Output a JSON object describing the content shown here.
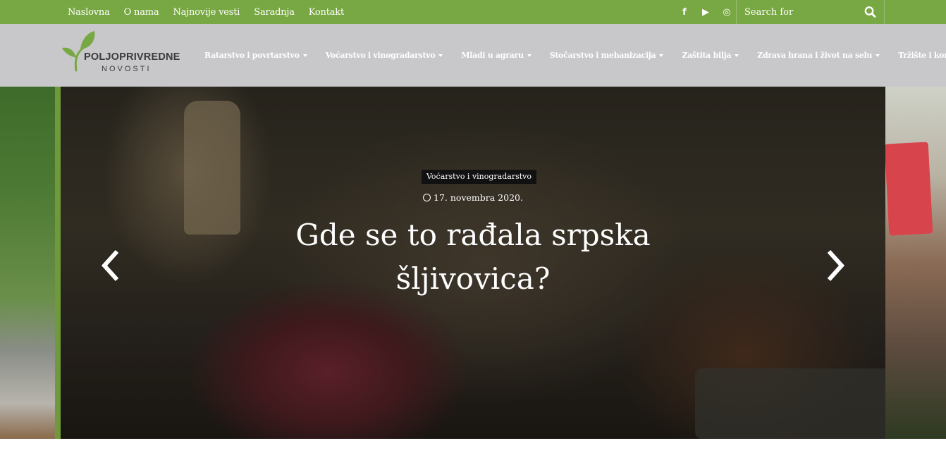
{
  "topbar": {
    "links": [
      "Naslovna",
      "O nama",
      "Najnovije vesti",
      "Saradnja",
      "Kontakt"
    ],
    "social": [
      "f",
      "▶",
      "◎"
    ],
    "social_icons": [
      "facebook-icon",
      "youtube-icon",
      "instagram-icon"
    ],
    "search_placeholder": "Search for",
    "bg_color": "#78a843"
  },
  "header": {
    "logo": {
      "line1": "POLJOPRIVREDNE",
      "line2": "NOVOSTI"
    },
    "nav": [
      "Ratarstvo i povrtarstvo",
      "Voćarstvo i vinogradarstvo",
      "Mladi u agraru",
      "Stočarstvo i mehanizacija",
      "Zaštita bilja",
      "Zdrava hrana i život na selu",
      "Tržište i konkursi"
    ],
    "bg_color": "#c8c8ca"
  },
  "slider": {
    "category": "Voćarstvo i vinogradarstvo",
    "date": "17. novembra 2020.",
    "title": "Gde se to rađala srpska šljivovica?"
  }
}
